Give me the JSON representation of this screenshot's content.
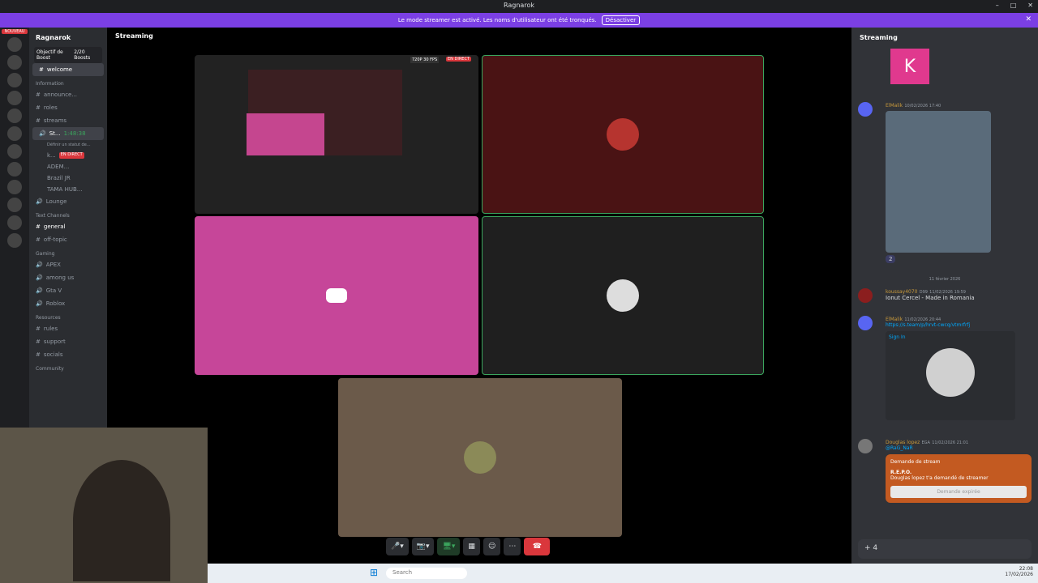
{
  "window": {
    "title": "Ragnarok"
  },
  "banner": {
    "text": "Le mode streamer est activé. Les noms d'utilisateur ont été tronqués.",
    "button": "Désactiver"
  },
  "servers": {
    "badge": "NOUVEAU"
  },
  "sidebar": {
    "server_name": "Ragnarok",
    "boost_label": "Objectif de Boost",
    "boost_count": "2/20 Boosts",
    "channels": [
      {
        "label": "welcome",
        "active": false
      },
      {
        "category": "Information"
      },
      {
        "label": "announce..."
      },
      {
        "label": "roles"
      },
      {
        "label": "streams"
      },
      {
        "label": "St...",
        "timer": "1:48:38",
        "active": true
      },
      {
        "label": "Lounge"
      },
      {
        "category": "Text Channels"
      },
      {
        "label": "general"
      },
      {
        "label": "off-topic"
      },
      {
        "category": "Gaming"
      },
      {
        "label": "APEX"
      },
      {
        "label": "among us"
      },
      {
        "label": "Gta V"
      },
      {
        "label": "Roblox"
      },
      {
        "category": "Resources"
      },
      {
        "label": "rules"
      },
      {
        "label": "support"
      },
      {
        "label": "socials"
      },
      {
        "category": "Community"
      }
    ],
    "status_hint": "Définir un statut de...",
    "voice_users": [
      "k...",
      "ADEM...",
      "Brazil JR",
      "TAMA HUB..."
    ],
    "live_badge": "EN DIRECT"
  },
  "main": {
    "header": "Streaming",
    "stream_badge": "720P 30 FPS",
    "live_badge": "EN DIRECT"
  },
  "chat": {
    "header": "Streaming",
    "avatar_letter": "K",
    "messages": [
      {
        "user": "ElMalik",
        "time": "10/02/2026 17:40",
        "reactions": "2"
      },
      {
        "divider": "11 février 2026"
      },
      {
        "user": "koussay4070",
        "tag": "D99",
        "time": "11/02/2026 19:59",
        "text": "Ionut Cercel - Made in Romania"
      },
      {
        "user": "ElMalik",
        "time": "11/02/2026 20:44",
        "link": "https://s.team/p/hrvt-cwcq/vtmrfrfj",
        "embed_title": "Sign In"
      },
      {
        "user": "Douglas lopez",
        "tag": "EGA",
        "time": "11/02/2026 21:01",
        "mention": "@RaG_NaR",
        "request_title": "Demande de stream",
        "game": "R.E.P.O.",
        "request_text": "Douglas lopez t'a demandé de streamer",
        "request_button": "Demande expirée"
      }
    ],
    "input_value": "4"
  },
  "taskbar": {
    "search": "Search",
    "time": "22:08",
    "date": "17/02/2026"
  }
}
